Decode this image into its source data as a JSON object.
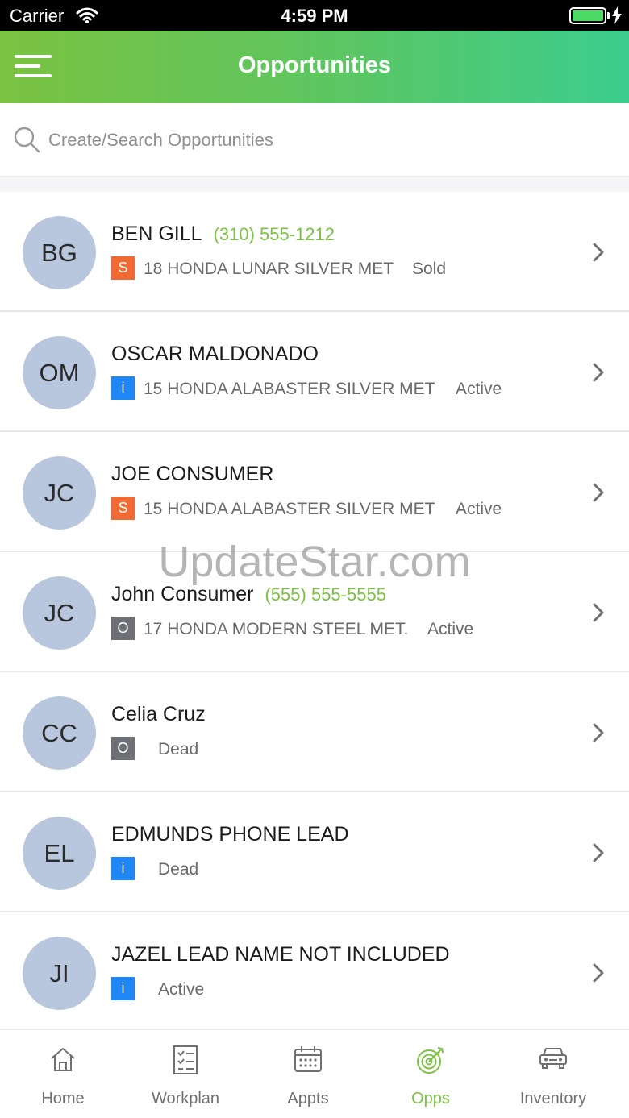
{
  "status_bar": {
    "carrier": "Carrier",
    "time": "4:59 PM"
  },
  "header": {
    "title": "Opportunities",
    "menu_icon": "hamburger-menu-icon"
  },
  "search": {
    "placeholder": "Create/Search Opportunities",
    "value": ""
  },
  "watermark": "UpdateStar.com",
  "colors": {
    "accent": "#7cc242",
    "badge_s": "#f06a33",
    "badge_i": "#1f86f5",
    "badge_o": "#6e7075",
    "avatar": "#b8c7de"
  },
  "opportunities": [
    {
      "initials": "BG",
      "name": "BEN GILL",
      "phone": "(310) 555-1212",
      "badge": "S",
      "vehicle": "18 HONDA LUNAR SILVER MET",
      "status": "Sold"
    },
    {
      "initials": "OM",
      "name": "OSCAR MALDONADO",
      "phone": "",
      "badge": "i",
      "vehicle": "15 HONDA ALABASTER SILVER MET",
      "status": "Active"
    },
    {
      "initials": "JC",
      "name": "JOE CONSUMER",
      "phone": "",
      "badge": "S",
      "vehicle": "15 HONDA ALABASTER SILVER MET",
      "status": "Active"
    },
    {
      "initials": "JC",
      "name": "John Consumer",
      "phone": "(555) 555-5555",
      "badge": "O",
      "vehicle": "17 HONDA MODERN STEEL MET.",
      "status": "Active"
    },
    {
      "initials": "CC",
      "name": "Celia Cruz",
      "phone": "",
      "badge": "O",
      "vehicle": "",
      "status": "Dead"
    },
    {
      "initials": "EL",
      "name": "EDMUNDS PHONE LEAD",
      "phone": "",
      "badge": "i",
      "vehicle": "",
      "status": "Dead"
    },
    {
      "initials": "JI",
      "name": "JAZEL LEAD NAME NOT INCLUDED",
      "phone": "",
      "badge": "i",
      "vehicle": "",
      "status": "Active"
    }
  ],
  "tabs": [
    {
      "label": "Home",
      "icon": "home-icon",
      "active": false
    },
    {
      "label": "Workplan",
      "icon": "checklist-icon",
      "active": false
    },
    {
      "label": "Appts",
      "icon": "calendar-icon",
      "active": false
    },
    {
      "label": "Opps",
      "icon": "target-icon",
      "active": true
    },
    {
      "label": "Inventory",
      "icon": "car-icon",
      "active": false
    }
  ]
}
